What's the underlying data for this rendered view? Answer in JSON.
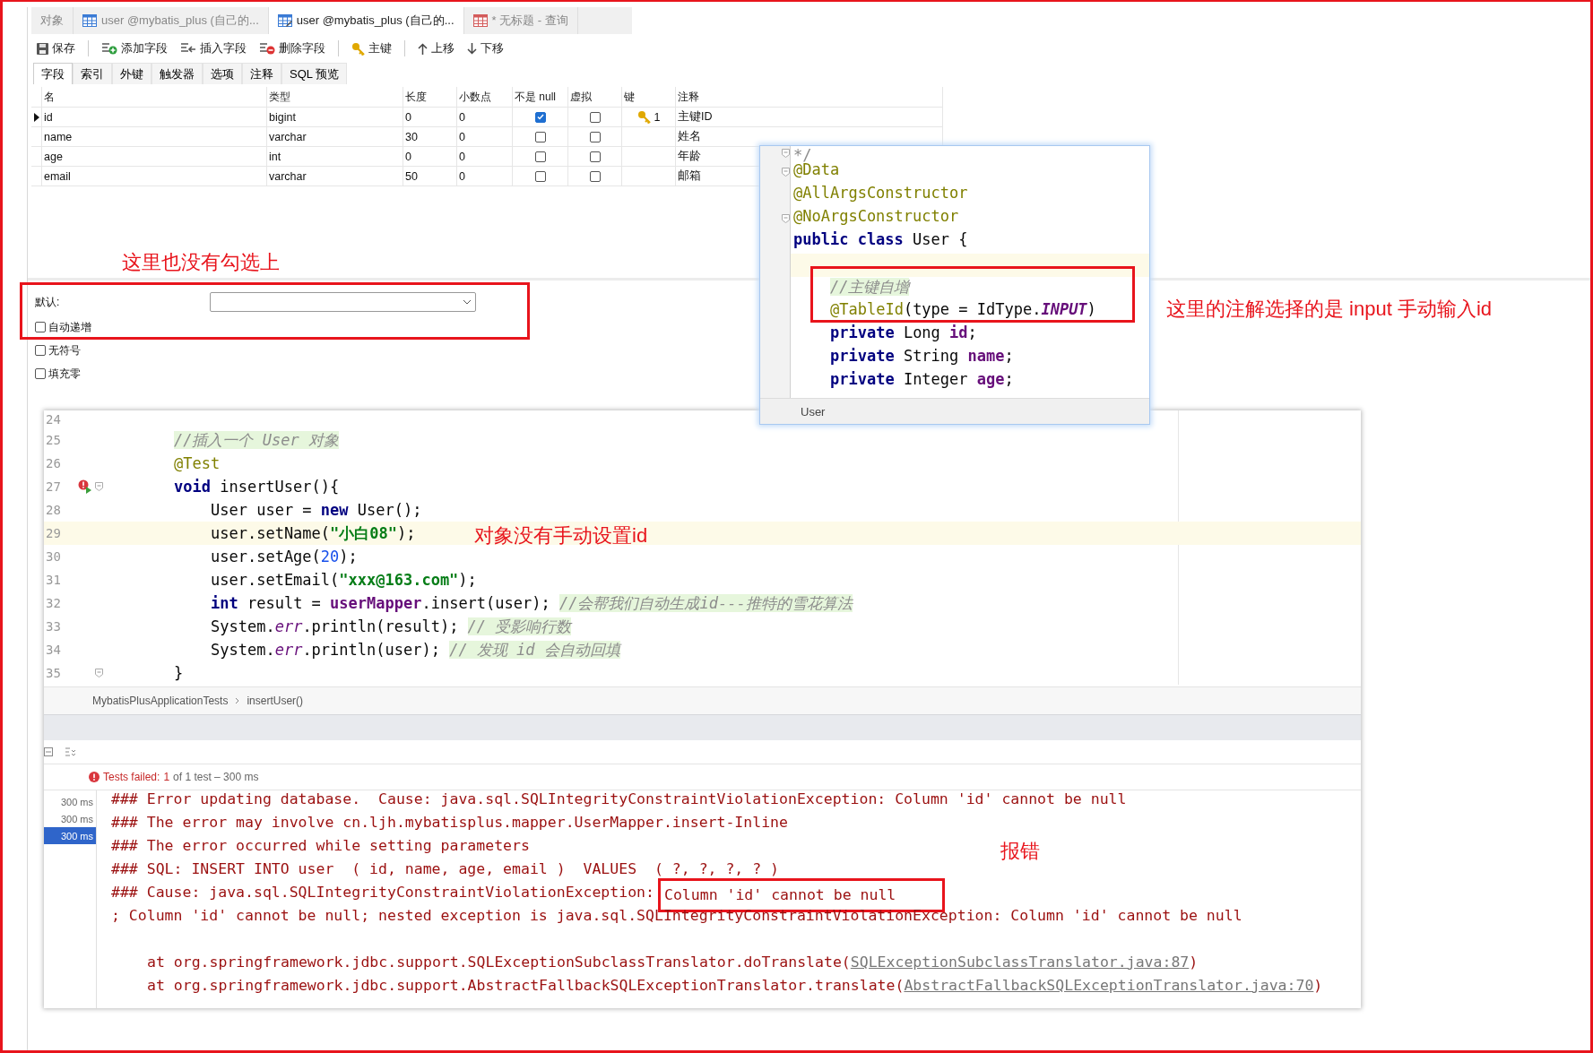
{
  "tabs": [
    {
      "label": "对象",
      "selected": false
    },
    {
      "label": "user @mybatis_plus (自己的...",
      "kind": "table",
      "selected": false
    },
    {
      "label": "user @mybatis_plus (自己的...",
      "kind": "design",
      "selected": true
    },
    {
      "label": "* 无标题 - 查询",
      "kind": "query",
      "selected": false
    }
  ],
  "toolbar": [
    {
      "label": "保存",
      "kind": "save",
      "separator_after": true
    },
    {
      "label": "添加字段",
      "kind": "add",
      "separator_after": false
    },
    {
      "label": "插入字段",
      "kind": "insert",
      "separator_after": false
    },
    {
      "label": "删除字段",
      "kind": "delete",
      "separator_after": true
    },
    {
      "label": "主键",
      "kind": "key",
      "separator_after": true
    },
    {
      "label": "上移",
      "kind": "up",
      "separator_after": false
    },
    {
      "label": "下移",
      "kind": "down",
      "separator_after": false
    }
  ],
  "sub_tabs": [
    {
      "label": "字段",
      "selected": true
    },
    {
      "label": "索引",
      "selected": false
    },
    {
      "label": "外键",
      "selected": false
    },
    {
      "label": "触发器",
      "selected": false
    },
    {
      "label": "选项",
      "selected": false
    },
    {
      "label": "注释",
      "selected": false
    },
    {
      "label": "SQL 预览",
      "selected": false
    }
  ],
  "fields_table": {
    "columns": [
      "名",
      "类型",
      "长度",
      "小数点",
      "不是 null",
      "虚拟",
      "键",
      "注释"
    ],
    "rows": [
      {
        "name": "id",
        "type": "bigint",
        "length": "0",
        "decimals": "0",
        "not_null": true,
        "virtual": false,
        "key": "1",
        "comment": "主键ID",
        "selected": true
      },
      {
        "name": "name",
        "type": "varchar",
        "length": "30",
        "decimals": "0",
        "not_null": false,
        "virtual": false,
        "comment": "姓名",
        "selected": false
      },
      {
        "name": "age",
        "type": "int",
        "length": "0",
        "decimals": "0",
        "not_null": false,
        "virtual": false,
        "comment": "年龄",
        "selected": false
      },
      {
        "name": "email",
        "type": "varchar",
        "length": "50",
        "decimals": "0",
        "not_null": false,
        "virtual": false,
        "comment": "邮箱",
        "selected": false
      }
    ]
  },
  "field_options": {
    "default_label": "默认:",
    "checkboxes": [
      {
        "label": "自动递增",
        "checked": false
      },
      {
        "label": "无符号",
        "checked": false
      },
      {
        "label": "填充零",
        "checked": false
      }
    ]
  },
  "class_popup": {
    "lines": [
      {
        "fold": true,
        "current": false,
        "tokens": [
          {
            "doc": "*/"
          }
        ]
      },
      {
        "fold": true,
        "current": false,
        "tokens": [
          {
            "ann": "@Data"
          }
        ]
      },
      {
        "fold": false,
        "current": false,
        "tokens": [
          {
            "ann": "@AllArgsConstructor"
          }
        ]
      },
      {
        "fold": true,
        "current": false,
        "tokens": [
          {
            "ann": "@NoArgsConstructor"
          }
        ]
      },
      {
        "fold": false,
        "current": false,
        "tokens": [
          {
            "kw": "public class"
          },
          {
            "plain": " User {"
          }
        ],
        "children": [
          {
            "fold": false,
            "current": true
          },
          {
            "fold": false,
            "current": false,
            "tokens": [
              {
                "comment": "//主键自增"
              }
            ]
          },
          {
            "fold": false,
            "current": false,
            "tokens": [
              {
                "ann": "@TableId"
              },
              {
                "plain": "(type = IdType."
              },
              {
                "const": "INPUT"
              },
              {
                "plain": ")"
              }
            ]
          },
          {
            "fold": false,
            "current": false,
            "tokens": [
              {
                "kw": "private"
              },
              {
                "plain": " Long "
              },
              {
                "field": "id"
              },
              {
                "plain": ";"
              }
            ]
          },
          {
            "fold": false,
            "current": false,
            "tokens": [
              {
                "kw": "private"
              },
              {
                "plain": " String "
              },
              {
                "field": "name"
              },
              {
                "plain": ";"
              }
            ]
          },
          {
            "fold": false,
            "current": false,
            "tokens": [
              {
                "kw": "private"
              },
              {
                "plain": " Integer "
              },
              {
                "field": "age"
              },
              {
                "plain": ";"
              }
            ]
          }
        ]
      }
    ],
    "footer": "User"
  },
  "editor": {
    "lines": [
      {
        "number": "24",
        "fold": false,
        "current": false,
        "failed_test": false
      },
      {
        "number": "25",
        "fold": false,
        "current": false,
        "failed_test": false,
        "tokens": [
          {
            "comment": "//插入一个 User 对象"
          }
        ]
      },
      {
        "number": "26",
        "fold": false,
        "current": false,
        "failed_test": false,
        "tokens": [
          {
            "ann": "@Test"
          }
        ]
      },
      {
        "number": "27",
        "fold": true,
        "current": false,
        "failed_test": true,
        "tokens": [
          {
            "kw": "void"
          },
          {
            "plain": " insertUser(){"
          }
        ],
        "children": [
          {
            "number": "28",
            "fold": false,
            "current": false,
            "failed_test": false,
            "tokens": [
              {
                "plain": "User user = "
              },
              {
                "kw": "new"
              },
              {
                "plain": " User();"
              }
            ]
          },
          {
            "number": "29",
            "fold": false,
            "current": true,
            "failed_test": false,
            "tokens": [
              {
                "plain": "user.setName("
              },
              {
                "str": "\"小白08\""
              },
              {
                "plain": ");"
              }
            ]
          },
          {
            "number": "30",
            "fold": false,
            "current": false,
            "failed_test": false,
            "tokens": [
              {
                "plain": "user.setAge("
              },
              {
                "num": "20"
              },
              {
                "plain": ");"
              }
            ]
          },
          {
            "number": "31",
            "fold": false,
            "current": false,
            "failed_test": false,
            "tokens": [
              {
                "plain": "user.setEmail("
              },
              {
                "str": "\"xxx@163.com\""
              },
              {
                "plain": ");"
              }
            ]
          },
          {
            "number": "32",
            "fold": false,
            "current": false,
            "failed_test": false,
            "tokens": [
              {
                "kw": "int"
              },
              {
                "plain": " result = "
              },
              {
                "field": "userMapper"
              },
              {
                "plain": ".insert(user); "
              },
              {
                "comment": "//会帮我们自动生成id---推特的雪花算法"
              }
            ]
          },
          {
            "number": "33",
            "fold": false,
            "current": false,
            "failed_test": false,
            "tokens": [
              {
                "plain": "System."
              },
              {
                "static": "err"
              },
              {
                "plain": ".println(result); "
              },
              {
                "comment": "// 受影响行数"
              }
            ]
          },
          {
            "number": "34",
            "fold": false,
            "current": false,
            "failed_test": false,
            "tokens": [
              {
                "plain": "System."
              },
              {
                "static": "err"
              },
              {
                "plain": ".println(user); "
              },
              {
                "comment": "// 发现 id 会自动回填"
              }
            ]
          }
        ]
      },
      {
        "number": "35",
        "fold": true,
        "current": false,
        "failed_test": false,
        "tokens": [
          {
            "plain": "}"
          }
        ]
      }
    ],
    "breadcrumb": [
      "MybatisPlusApplicationTests",
      "insertUser()"
    ]
  },
  "test_panel": {
    "status": {
      "label": "Tests failed:",
      "count": "1",
      "summary": "of 1 test – 300 ms"
    },
    "durations": [
      {
        "label": "300 ms",
        "selected": false
      },
      {
        "label": "300 ms",
        "selected": false
      },
      {
        "label": "300 ms",
        "selected": true
      }
    ],
    "console": [
      {
        "text": "### Error updating database.  Cause: java.sql.SQLIntegrityConstraintViolationException: Column 'id' cannot be null"
      },
      {
        "text": "### The error may involve cn.ljh.mybatisplus.mapper.UserMapper.insert-Inline"
      },
      {
        "text": "### The error occurred while setting parameters"
      },
      {
        "text": "### SQL: INSERT INTO user  ( id, name, age, email )  VALUES  ( ?, ?, ?, ? )"
      },
      {
        "text": "### Cause: java.sql.SQLIntegrityConstraintViolationException:",
        "boxed": "Column 'id' cannot be null"
      },
      {
        "text": "; Column 'id' cannot be null; nested exception is java.sql.SQLIntegrityConstraintViolationException: Column 'id' cannot be null"
      }
    ],
    "stack_trace": [
      {
        "text": "at org.springframework.jdbc.support.SQLExceptionSubclassTranslator.doTranslate(",
        "link": "SQLExceptionSubclassTranslator.java:87",
        "after": ")"
      },
      {
        "text": "at org.springframework.jdbc.support.AbstractFallbackSQLExceptionTranslator.translate(",
        "link": "AbstractFallbackSQLExceptionTranslator.java:70",
        "after": ")"
      }
    ]
  },
  "notes": [
    {
      "text": "这里也没有勾选上"
    },
    {
      "text": "这里的注解选择的是 input 手动输入id"
    },
    {
      "text": "对象没有手动设置id"
    },
    {
      "text": "报错"
    }
  ]
}
